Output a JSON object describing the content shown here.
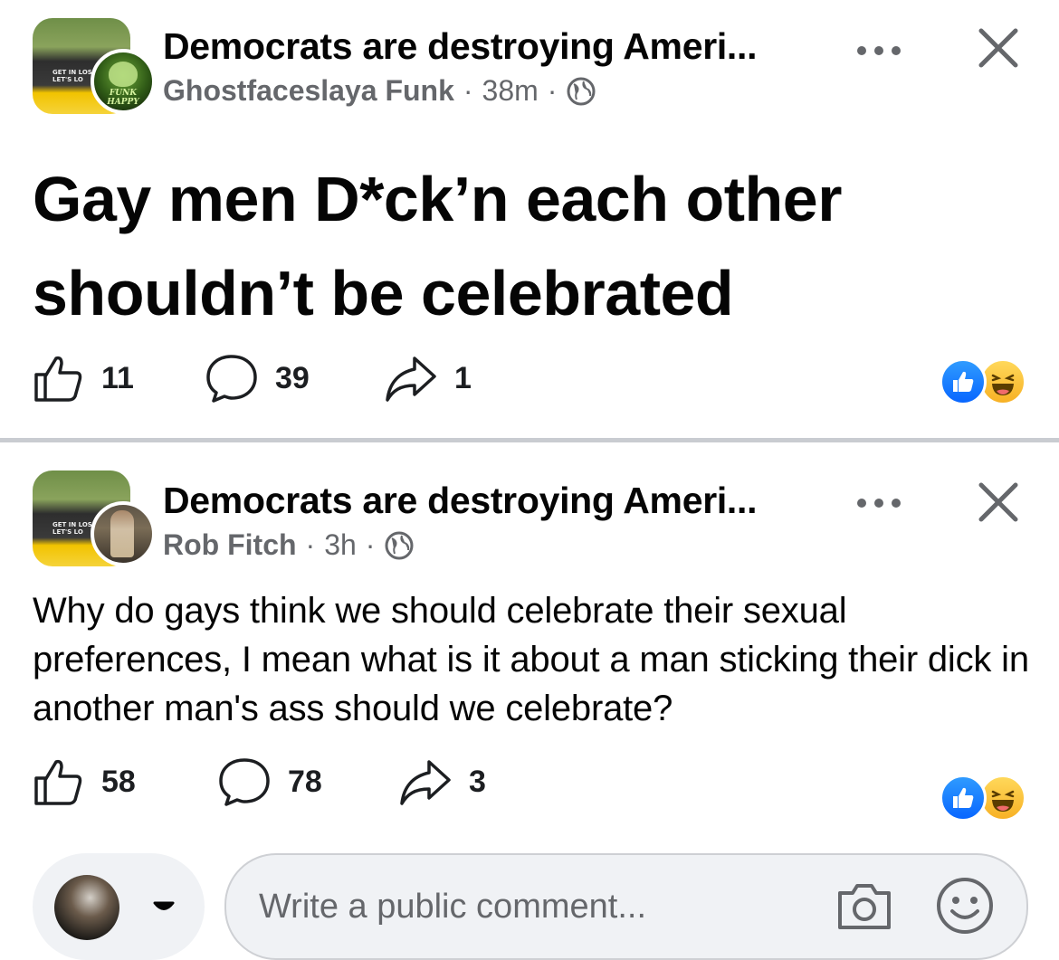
{
  "posts": [
    {
      "group_name": "Democrats are destroying Ameri...",
      "author": "Ghostfaceslaya Funk",
      "time": "38m",
      "separator": "·",
      "body": "Gay men D*ck’n each other shouldn’t be celebrated",
      "avatar_text": "FUNK HAPPY",
      "group_thumb_text": "GET IN LOSE\nLET'S LO",
      "likes": "11",
      "comments": "39",
      "shares": "1",
      "reactions": [
        "like",
        "haha"
      ]
    },
    {
      "group_name": "Democrats are destroying Ameri...",
      "author": "Rob Fitch",
      "time": "3h",
      "separator": "·",
      "body": "Why do gays think we should celebrate their sexual preferences, I mean what is it about a man sticking their dick in another man's ass should we celebrate?",
      "group_thumb_text": "GET IN LOSE\nLET'S LO",
      "likes": "58",
      "comments": "78",
      "shares": "3",
      "reactions": [
        "like",
        "haha"
      ]
    }
  ],
  "composer": {
    "placeholder": "Write a public comment..."
  },
  "colors": {
    "meta_gray": "#65676b",
    "like_blue": "#0866ff",
    "haha_yellow": "#f7b125",
    "divider": "#c9ccd1"
  },
  "icons": [
    "globe-icon",
    "more-icon",
    "close-icon",
    "like-icon",
    "comment-icon",
    "share-icon",
    "camera-icon",
    "smiley-icon",
    "caret-down-icon"
  ]
}
